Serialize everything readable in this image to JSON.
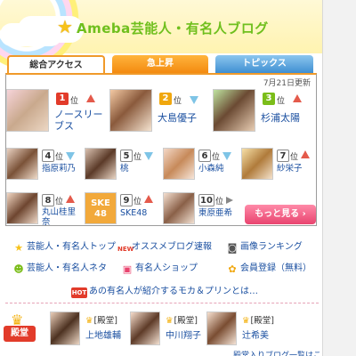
{
  "header": {
    "title": "Ameba芸能人・有名人ブログ",
    "star_icon": "star-icon"
  },
  "tabs": [
    {
      "label": "総合アクセス",
      "active": true
    },
    {
      "label": "急上昇",
      "active": false
    },
    {
      "label": "トピックス",
      "active": false
    }
  ],
  "updated": "7月21日更新",
  "rank_unit": "位",
  "ranking": [
    {
      "rank": "1",
      "name": "ノースリーブス",
      "trend": "up"
    },
    {
      "rank": "2",
      "name": "大島優子",
      "trend": "down"
    },
    {
      "rank": "3",
      "name": "杉浦太陽",
      "trend": "up"
    },
    {
      "rank": "4",
      "name": "指原莉乃",
      "trend": "down"
    },
    {
      "rank": "5",
      "name": "桃",
      "trend": "down"
    },
    {
      "rank": "6",
      "name": "小森純",
      "trend": "down"
    },
    {
      "rank": "7",
      "name": "紗栄子",
      "trend": "up"
    },
    {
      "rank": "8",
      "name": "丸山桂里奈",
      "trend": "up"
    },
    {
      "rank": "9",
      "name": "SKE48",
      "trend": "up"
    },
    {
      "rank": "10",
      "name": "東原亜希",
      "trend": "same"
    }
  ],
  "more_button": "もっと見る ›",
  "links": {
    "ranking_top": "芸能人・有名人トップ",
    "recommend_blogs": "オススメブログ速報",
    "image_ranking": "画像ランキング",
    "neta": "芸能人・有名人ネタ",
    "shop": "有名人ショップ",
    "register": "会員登録（無料）",
    "new_badge": "NEW",
    "hot_badge": "HOT",
    "promo": "あの有名人が紹介するモカ＆プリンとは…"
  },
  "hall_of_fame": {
    "label": "殿堂",
    "tag": "[殿堂]",
    "members": [
      "上地雄輔",
      "中川翔子",
      "辻希美"
    ],
    "footer": "殿堂入りブログ一覧はこちら"
  }
}
